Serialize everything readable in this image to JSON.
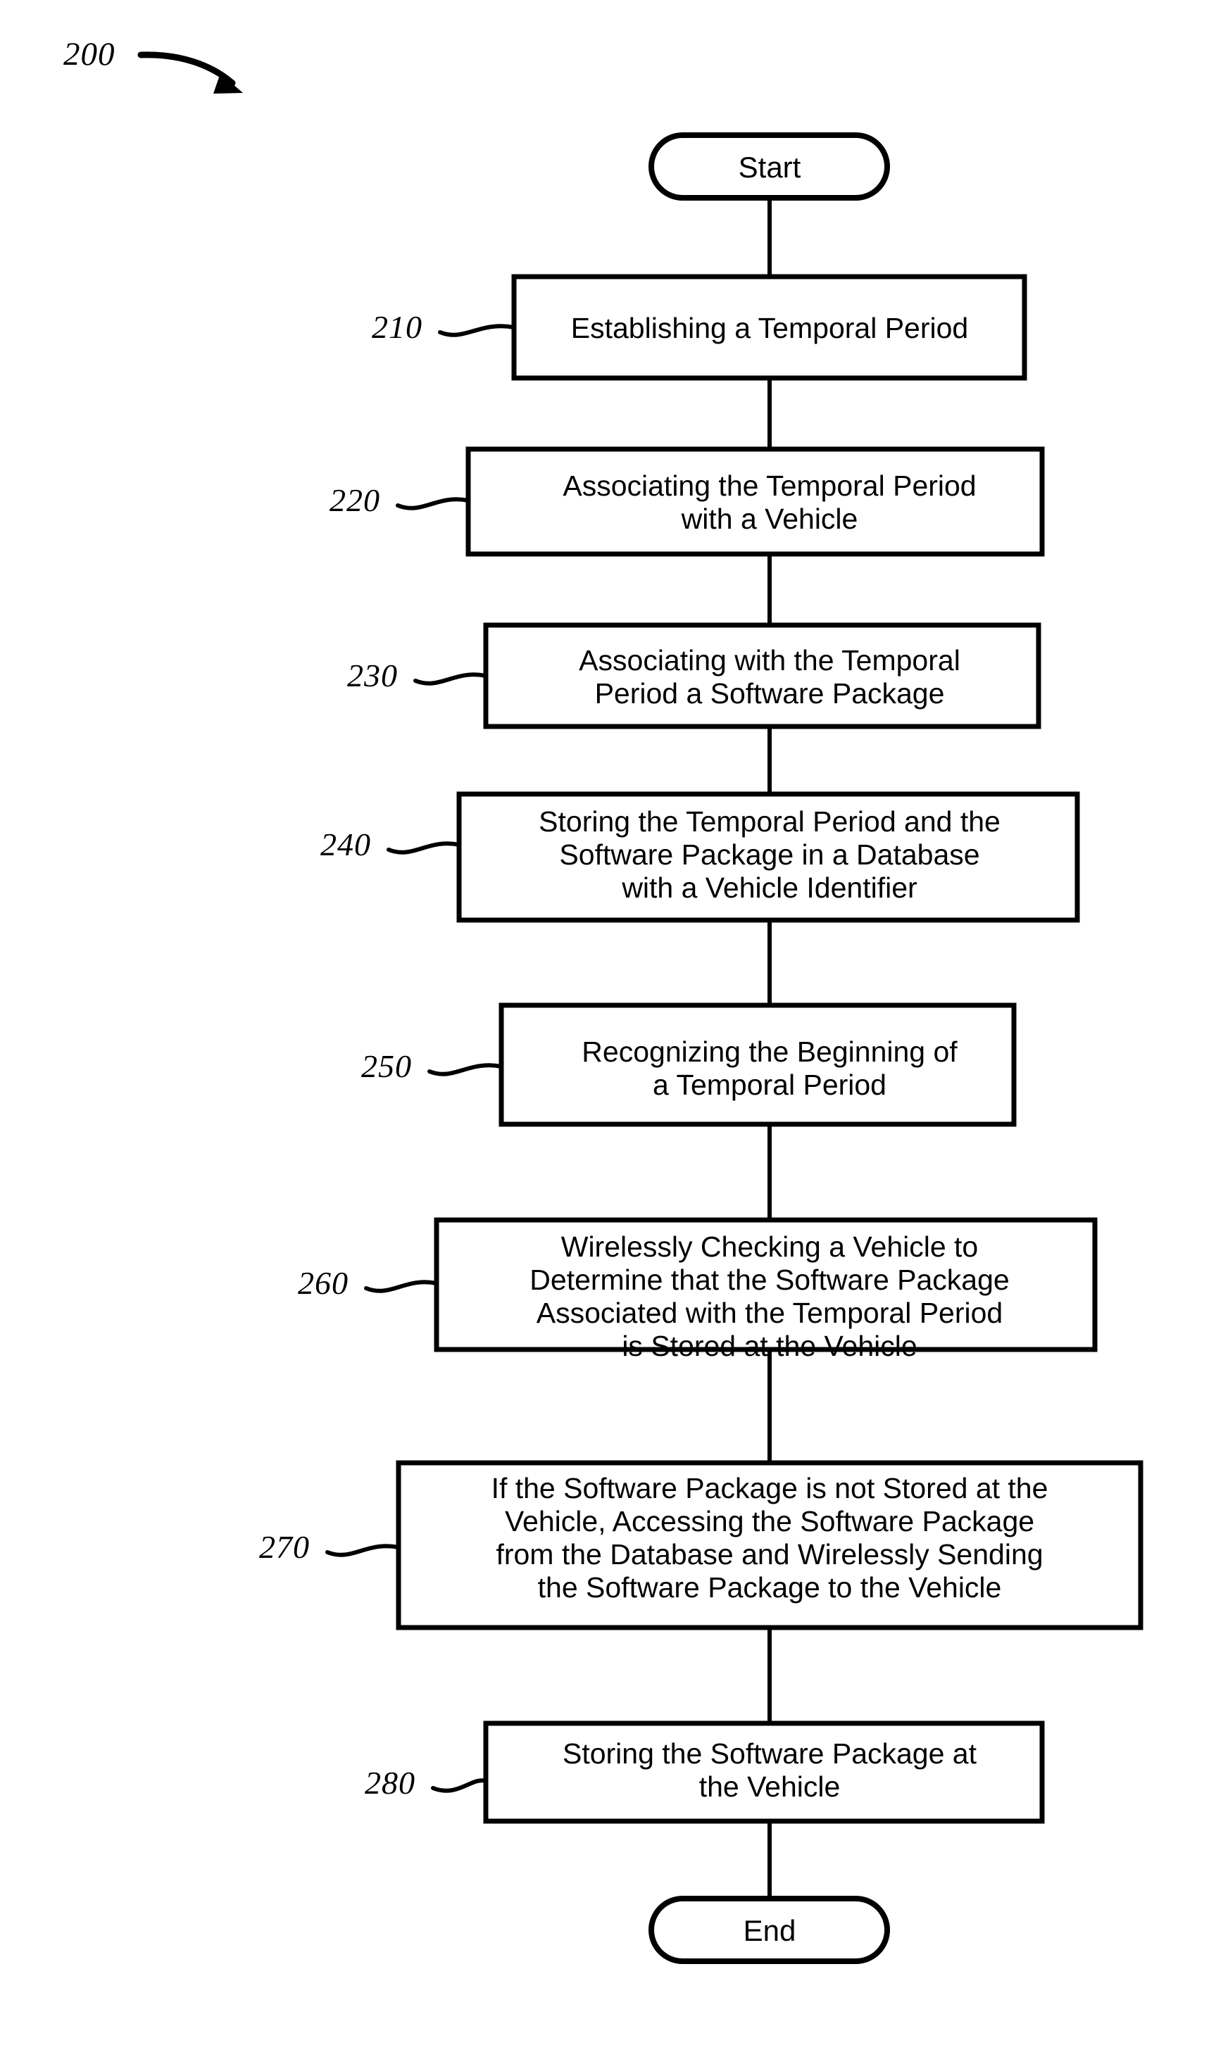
{
  "figure": {
    "number": "200",
    "arrow_icon": "curved-arrow-icon"
  },
  "flowchart": {
    "title": "200",
    "start": {
      "label": "Start",
      "shape": "terminator"
    },
    "end": {
      "label": "End",
      "shape": "terminator"
    },
    "steps": [
      {
        "ref": "210",
        "lines": [
          "Establishing a Temporal Period"
        ],
        "text": "Establishing a Temporal Period"
      },
      {
        "ref": "220",
        "lines": [
          "Associating the Temporal Period",
          "with a Vehicle"
        ],
        "text": "Associating the Temporal Period with a Vehicle"
      },
      {
        "ref": "230",
        "lines": [
          "Associating with the Temporal",
          "Period a Software Package"
        ],
        "text": "Associating with the Temporal Period a Software Package"
      },
      {
        "ref": "240",
        "lines": [
          "Storing the Temporal Period and the",
          "Software Package in a Database",
          "with a Vehicle Identifier"
        ],
        "text": "Storing the Temporal Period and the Software Package in a Database with a Vehicle Identifier"
      },
      {
        "ref": "250",
        "lines": [
          "Recognizing the Beginning of",
          "a Temporal Period"
        ],
        "text": "Recognizing the Beginning of a Temporal Period"
      },
      {
        "ref": "260",
        "lines": [
          "Wirelessly Checking a Vehicle to",
          "Determine that the Software Package",
          "Associated with the Temporal Period",
          "is Stored at the Vehicle"
        ],
        "text": "Wirelessly Checking a Vehicle to Determine that the Software Package Associated with the Temporal Period is Stored at the Vehicle"
      },
      {
        "ref": "270",
        "lines": [
          "If the Software Package is not Stored at the",
          "Vehicle, Accessing the Software Package",
          "from the Database and Wirelessly Sending",
          "the Software Package to the Vehicle"
        ],
        "text": "If the Software Package is not Stored at the Vehicle, Accessing the Software Package from the Database and Wirelessly Sending the Software Package to the Vehicle"
      },
      {
        "ref": "280",
        "lines": [
          "Storing the Software Package at",
          "the Vehicle"
        ],
        "text": "Storing the Software Package at the Vehicle"
      }
    ]
  },
  "colors": {
    "stroke": "#000000",
    "fill": "#ffffff",
    "background": "#ffffff"
  }
}
